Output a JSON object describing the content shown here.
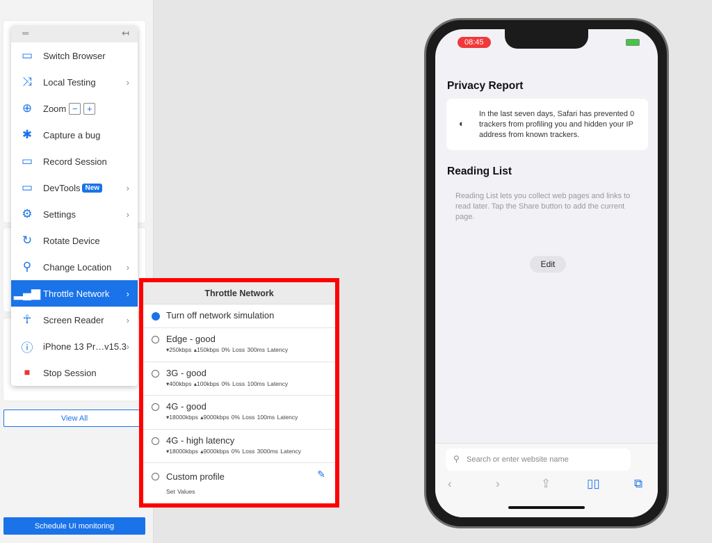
{
  "sidebar": {
    "menu_items": [
      {
        "label": "Switch Browser",
        "icon": "devices-icon"
      },
      {
        "label": "Local Testing",
        "icon": "shuffle-icon",
        "submenu": true
      },
      {
        "label": "Zoom",
        "icon": "zoom-in-icon",
        "minus": "−",
        "plus": "+"
      },
      {
        "label": "Capture a bug",
        "icon": "bug-icon"
      },
      {
        "label": "Record Session",
        "icon": "video-icon"
      },
      {
        "label": "DevTools",
        "icon": "window-icon",
        "badge": "New",
        "submenu": true
      },
      {
        "label": "Settings",
        "icon": "gear-icon",
        "submenu": true
      },
      {
        "label": "Rotate Device",
        "icon": "rotate-icon"
      },
      {
        "label": "Change Location",
        "icon": "location-pin-icon",
        "submenu": true
      },
      {
        "label": "Throttle Network",
        "icon": "signal-bars-icon",
        "submenu": true,
        "active": true
      },
      {
        "label": "Screen Reader",
        "icon": "accessibility-icon",
        "submenu": true
      },
      {
        "label": "iPhone 13 Pr…v15.3",
        "icon": "info-icon",
        "submenu": true
      },
      {
        "label": "Stop Session",
        "icon": "stop-icon"
      }
    ],
    "view_all": "View All",
    "schedule": "Schedule UI monitoring"
  },
  "throttle": {
    "title": "Throttle Network",
    "options": [
      {
        "label": "Turn off network simulation",
        "selected": true
      },
      {
        "label": "Edge - good",
        "stats": "▾250kbps  ▴150kbps  0% Loss  300ms Latency"
      },
      {
        "label": "3G - good",
        "stats": "▾400kbps  ▴100kbps  0% Loss  100ms Latency"
      },
      {
        "label": "4G - good",
        "stats": "▾18000kbps  ▴9000kbps  0% Loss  100ms Latency"
      },
      {
        "label": "4G - high latency",
        "stats": "▾18000kbps  ▴9000kbps  0% Loss  3000ms Latency"
      },
      {
        "label": "Custom profile",
        "stats": "Set Values"
      }
    ]
  },
  "phone": {
    "time": "08:45",
    "privacy_title": "Privacy Report",
    "privacy_text": "In the last seven days, Safari has prevented 0 trackers from profiling you and hidden your IP address from known trackers.",
    "reading_title": "Reading List",
    "reading_text": "Reading List lets you collect web pages and links to read later. Tap the Share button to add the current page.",
    "edit": "Edit",
    "search_placeholder": "Search or enter website name"
  },
  "colors": {
    "accent": "#1a73e8",
    "highlight": "#ff0000"
  }
}
